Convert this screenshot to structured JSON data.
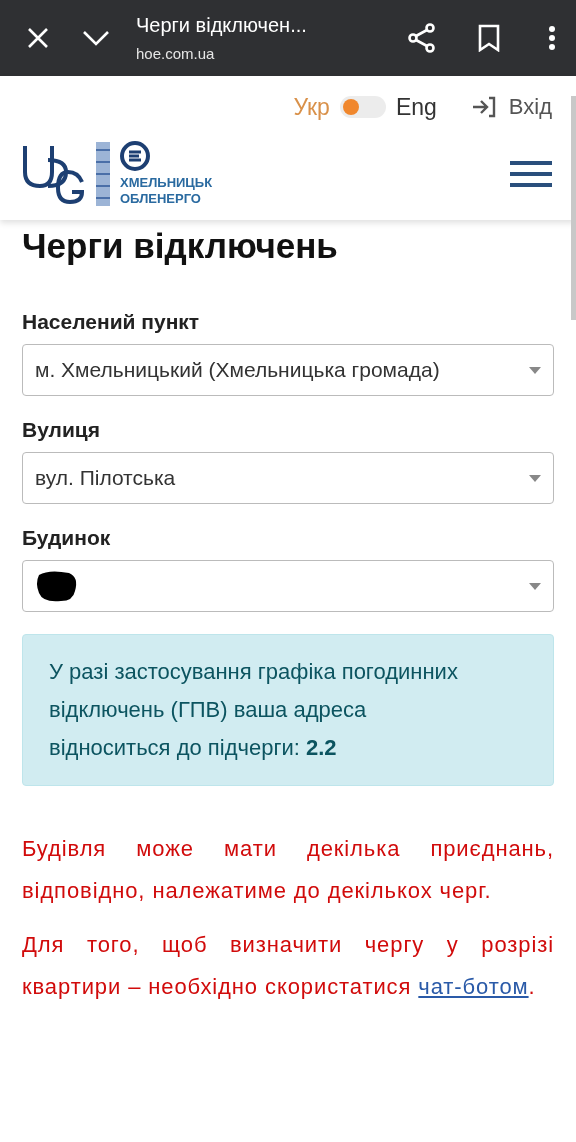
{
  "browser_bar": {
    "title": "Черги відключен...",
    "url": "hoe.com.ua"
  },
  "header": {
    "lang_left": "Укр",
    "lang_right": "Eng",
    "lang_switch_on": false,
    "login": "Вхід",
    "logo_text": [
      "ХМЕЛЬНИЦЬК",
      "ОБЛЕНЕРГО"
    ]
  },
  "page_title": "Черги відключень",
  "fields": [
    {
      "label": "Населений пункт",
      "value": "м. Хмельницький (Хмельницька громада)",
      "redacted": false
    },
    {
      "label": "Вулиця",
      "value": "вул. Пілотська",
      "redacted": false
    },
    {
      "label": "Будинок",
      "redacted": true
    }
  ],
  "info": {
    "text": "У разі застосування графіка погодинних відключень (ГПВ) ваша адреса відноситься до підчерги:",
    "queue": "2.2"
  },
  "notes": [
    {
      "text": "Будівля може мати декілька приєднань, відповідно, належатиме до декількох черг."
    },
    {
      "text": "Для того, щоб визначити чергу у розрізі квартири – необхідно скористатися",
      "link": "чат-ботом",
      "after": "."
    }
  ]
}
